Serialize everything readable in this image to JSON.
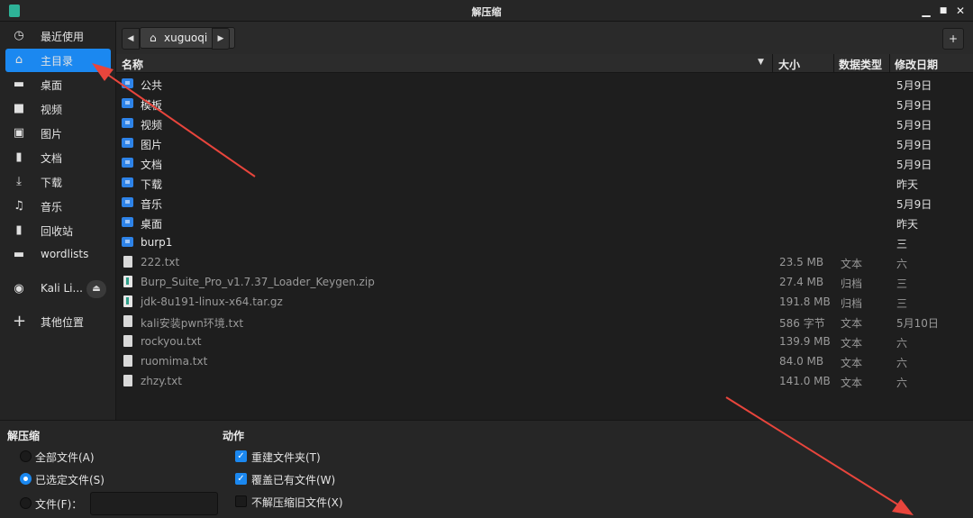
{
  "window": {
    "title": "解压缩"
  },
  "window_controls": {
    "minimize": "▁",
    "maximize": "■",
    "close": "✕"
  },
  "sidebar": {
    "items": [
      {
        "label": "最近使用",
        "icon": "clock-icon",
        "glyph": "◷"
      },
      {
        "label": "主目录",
        "icon": "home-icon",
        "glyph": "⌂",
        "active": true
      },
      {
        "label": "桌面",
        "icon": "desktop-icon",
        "glyph": "▬"
      },
      {
        "label": "视频",
        "icon": "video-icon",
        "glyph": "■"
      },
      {
        "label": "图片",
        "icon": "image-icon",
        "glyph": "▣"
      },
      {
        "label": "文档",
        "icon": "document-icon",
        "glyph": "▮"
      },
      {
        "label": "下载",
        "icon": "download-icon",
        "glyph": "⤓"
      },
      {
        "label": "音乐",
        "icon": "music-icon",
        "glyph": "♫"
      },
      {
        "label": "回收站",
        "icon": "trash-icon",
        "glyph": "▮"
      },
      {
        "label": "wordlists",
        "icon": "folder-icon",
        "glyph": "▬"
      },
      {
        "label": "Kali Li...",
        "icon": "disc-icon",
        "glyph": "◉"
      },
      {
        "label": "其他位置",
        "icon": "plus-icon",
        "glyph": "+"
      }
    ]
  },
  "pathbar": {
    "crumb": "xuguoqi",
    "back": "◀",
    "forward": "▶",
    "new_folder": "+"
  },
  "columns": {
    "name": "名称",
    "size": "大小",
    "type": "数据类型",
    "modified": "修改日期"
  },
  "files": [
    {
      "name": "公共",
      "kind": "dir",
      "size": "",
      "type": "",
      "date": "5月9日"
    },
    {
      "name": "模板",
      "kind": "dir",
      "size": "",
      "type": "",
      "date": "5月9日"
    },
    {
      "name": "视频",
      "kind": "dir",
      "size": "",
      "type": "",
      "date": "5月9日"
    },
    {
      "name": "图片",
      "kind": "dir",
      "size": "",
      "type": "",
      "date": "5月9日"
    },
    {
      "name": "文档",
      "kind": "dir",
      "size": "",
      "type": "",
      "date": "5月9日"
    },
    {
      "name": "下载",
      "kind": "dir",
      "size": "",
      "type": "",
      "date": "昨天"
    },
    {
      "name": "音乐",
      "kind": "dir",
      "size": "",
      "type": "",
      "date": "5月9日"
    },
    {
      "name": "桌面",
      "kind": "dir",
      "size": "",
      "type": "",
      "date": "昨天"
    },
    {
      "name": "burp1",
      "kind": "dir",
      "size": "",
      "type": "",
      "date": "三"
    },
    {
      "name": "222.txt",
      "kind": "doc",
      "size": "23.5 MB",
      "type": "文本",
      "date": "六"
    },
    {
      "name": "Burp_Suite_Pro_v1.7.37_Loader_Keygen.zip",
      "kind": "zip",
      "size": "27.4 MB",
      "type": "归档",
      "date": "三"
    },
    {
      "name": "jdk-8u191-linux-x64.tar.gz",
      "kind": "zip",
      "size": "191.8 MB",
      "type": "归档",
      "date": "三"
    },
    {
      "name": "kali安装pwn环境.txt",
      "kind": "doc",
      "size": "586 字节",
      "type": "文本",
      "date": "5月10日"
    },
    {
      "name": "rockyou.txt",
      "kind": "doc",
      "size": "139.9 MB",
      "type": "文本",
      "date": "六"
    },
    {
      "name": "ruomima.txt",
      "kind": "doc",
      "size": "84.0 MB",
      "type": "文本",
      "date": "六"
    },
    {
      "name": "zhzy.txt",
      "kind": "doc",
      "size": "141.0 MB",
      "type": "文本",
      "date": "六"
    }
  ],
  "extract": {
    "title": "解压缩",
    "all_files": "全部文件(A)",
    "selected_files": "已选定文件(S)",
    "files_pattern": "文件(F)：",
    "selected": "selected_files",
    "pattern_value": ""
  },
  "actions": {
    "title": "动作",
    "recreate_folders": {
      "label": "重建文件夹(T)",
      "checked": true
    },
    "overwrite": {
      "label": "覆盖已有文件(W)",
      "checked": true
    },
    "skip_older": {
      "label": "不解压缩旧文件(X)",
      "checked": false
    }
  },
  "colors": {
    "accent": "#1b88f0",
    "arrow": "#e8453c"
  }
}
